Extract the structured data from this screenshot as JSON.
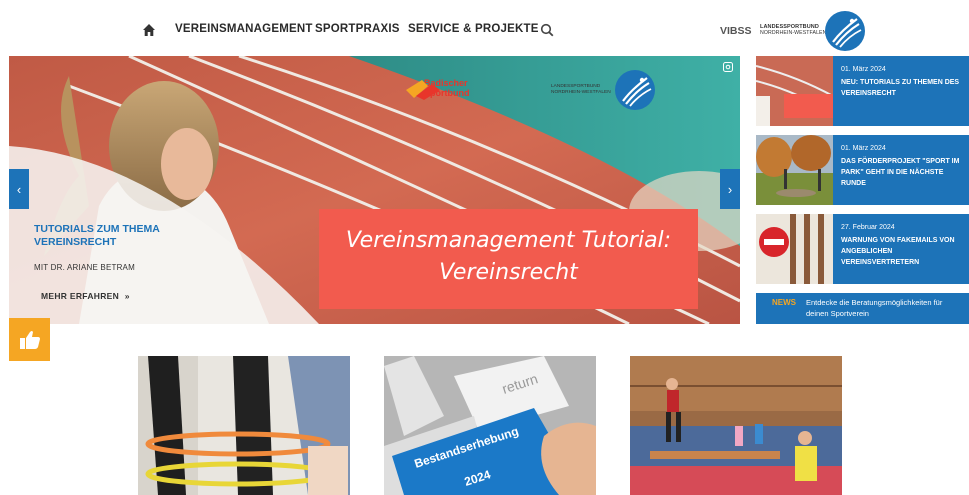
{
  "header": {
    "nav": [
      {
        "label": "VEREINSMANAGEMENT"
      },
      {
        "label": "SPORTPRAXIS"
      },
      {
        "label": "SERVICE & PROJEKTE"
      }
    ],
    "vibss_label": "VIBSS",
    "logo_text_line1": "LANDESSPORTBUND",
    "logo_text_line2": "NORDRHEIN-WESTFALEN",
    "icons": [
      "home-icon",
      "search-icon"
    ]
  },
  "hero": {
    "title": "TUTORIALS ZUM THEMA VEREINSRECHT",
    "subtitle": "MIT DR. ARIANE BETRAM",
    "more_label": "MEHR ERFAHREN",
    "more_arrow": "»",
    "panel_line1": "Vereinsmanagement Tutorial:",
    "panel_line2": "Vereinsrecht",
    "partner_logo_line1": "Badischer",
    "partner_logo_line2": "Sportbund",
    "lsb_line1": "LANDESSPORTBUND",
    "lsb_line2": "NORDRHEIN-WESTFALEN",
    "prev_arrow": "‹",
    "next_arrow": "›"
  },
  "news": [
    {
      "date": "01. März 2024",
      "title": "NEU: TUTORIALS ZU THEMEN DES VEREINSRECHT"
    },
    {
      "date": "01. März 2024",
      "title": "DAS FÖRDERPROJEKT \"SPORT IM PARK\" GEHT IN DIE NÄCHSTE RUNDE"
    },
    {
      "date": "27. Februar 2024",
      "title": "WARNUNG VON FAKEMAILS VON ANGEBLICHEN VEREINSVERTRETERN"
    }
  ],
  "ticker": {
    "tag": "NEWS",
    "text": "Entdecke die Beratungsmöglichkeiten für deinen Sportverein"
  },
  "cards": [
    {
      "caption": ""
    },
    {
      "key_label": "return",
      "key_text_line1": "Bestandserhebung",
      "key_text_line2": "2024"
    },
    {
      "caption": ""
    }
  ],
  "colors": {
    "brand_blue": "#1d73b8",
    "accent_orange": "#f5a623",
    "panel_red": "#f25b4e",
    "text_dark": "#2a2a2a"
  },
  "like_button_icon": "thumbs-up-icon"
}
